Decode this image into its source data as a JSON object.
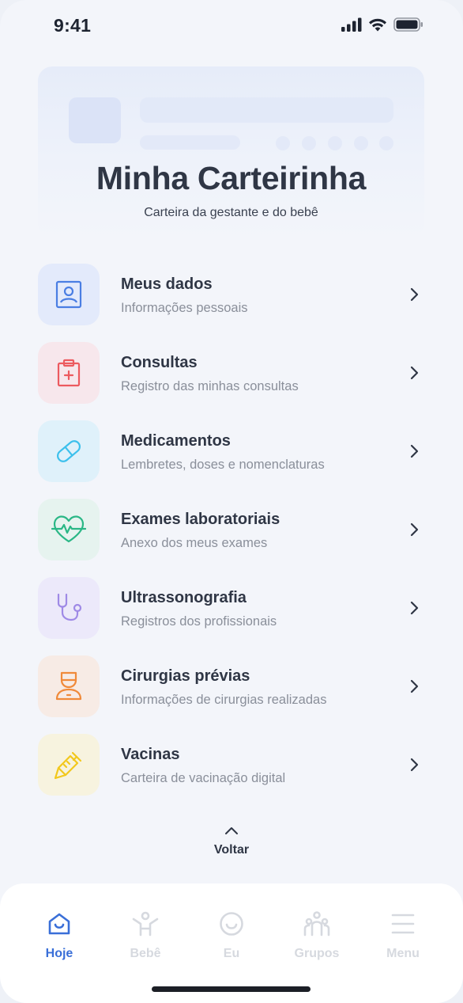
{
  "status_bar": {
    "time": "9:41"
  },
  "header": {
    "title": "Minha Carteirinha",
    "subtitle": "Carteira da gestante e do bebê"
  },
  "menu": {
    "items": [
      {
        "title": "Meus dados",
        "subtitle": "Informações pessoais",
        "icon": "id-card-icon",
        "tile_color": "#e3eafb",
        "icon_color": "#4a7ee3"
      },
      {
        "title": "Consultas",
        "subtitle": "Registro das minhas consultas",
        "icon": "clipboard-medical-icon",
        "tile_color": "#f7e7ec",
        "icon_color": "#ec5a5f"
      },
      {
        "title": "Medicamentos",
        "subtitle": "Lembretes, doses e nomenclaturas",
        "icon": "pill-icon",
        "tile_color": "#dff1fa",
        "icon_color": "#3cc0ec"
      },
      {
        "title": "Exames laboratoriais",
        "subtitle": "Anexo dos meus exames",
        "icon": "heart-pulse-icon",
        "tile_color": "#e6f3ef",
        "icon_color": "#2ab786"
      },
      {
        "title": "Ultrassonografia",
        "subtitle": "Registros dos profissionais",
        "icon": "stethoscope-icon",
        "tile_color": "#ece9fa",
        "icon_color": "#9f8ae6"
      },
      {
        "title": "Cirurgias prévias",
        "subtitle": "Informações de cirurgias realizadas",
        "icon": "surgeon-icon",
        "tile_color": "#f7ebe5",
        "icon_color": "#f08a3a"
      },
      {
        "title": "Vacinas",
        "subtitle": "Carteira de vacinação digital",
        "icon": "syringe-icon",
        "tile_color": "#f7f3df",
        "icon_color": "#f2c81d"
      }
    ]
  },
  "back": {
    "label": "Voltar"
  },
  "tab_bar": {
    "tabs": [
      {
        "label": "Hoje",
        "icon": "home-icon",
        "active": true
      },
      {
        "label": "Bebê",
        "icon": "baby-icon",
        "active": false
      },
      {
        "label": "Eu",
        "icon": "smile-icon",
        "active": false
      },
      {
        "label": "Grupos",
        "icon": "group-icon",
        "active": false
      },
      {
        "label": "Menu",
        "icon": "hamburger-menu-icon",
        "active": false
      }
    ]
  },
  "colors": {
    "accent": "#3a6fd8",
    "inactive": "#d6d9df",
    "background": "#f3f5fa"
  }
}
